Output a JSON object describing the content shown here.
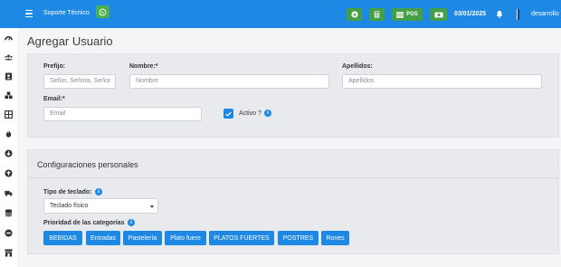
{
  "header": {
    "support_label": "Soporte Técnico",
    "pos_label": "POS",
    "date": "03/01/2025",
    "user_name": "desarrollo"
  },
  "page": {
    "title": "Agregar Usuario"
  },
  "form": {
    "prefijo_label": "Prefijo:",
    "prefijo_placeholder": "Señor, Señora, Señor",
    "nombre_label": "Nombre:*",
    "nombre_placeholder": "Nombre",
    "apellidos_label": "Apellidos:",
    "apellidos_placeholder": "Apellidos",
    "email_label": "Email:*",
    "email_placeholder": "Email",
    "activo_label": "Activo ?",
    "activo_checked": true
  },
  "config": {
    "title": "Configuraciones personales",
    "teclado_label": "Tipo de teclado:",
    "teclado_value": "Teclado físico",
    "prioridad_label": "Prioridad de las categorías",
    "categories": [
      "BEBIDAS",
      "Entradas",
      "Pastelería",
      "Plato fuere",
      "PLATOS FUERTES",
      "POSTRES",
      "Rones"
    ]
  },
  "colors": {
    "primary": "#1e88e5",
    "success": "#43a047",
    "panel": "#e9eaee"
  },
  "icons": {
    "sidebar": [
      "dashboard-icon",
      "users-icon",
      "contacts-icon",
      "cubes-icon",
      "table-icon",
      "fire-icon",
      "arrow-circle-down-icon",
      "arrow-circle-up-icon",
      "truck-icon",
      "database-icon",
      "minus-circle-icon",
      "store-icon"
    ]
  }
}
